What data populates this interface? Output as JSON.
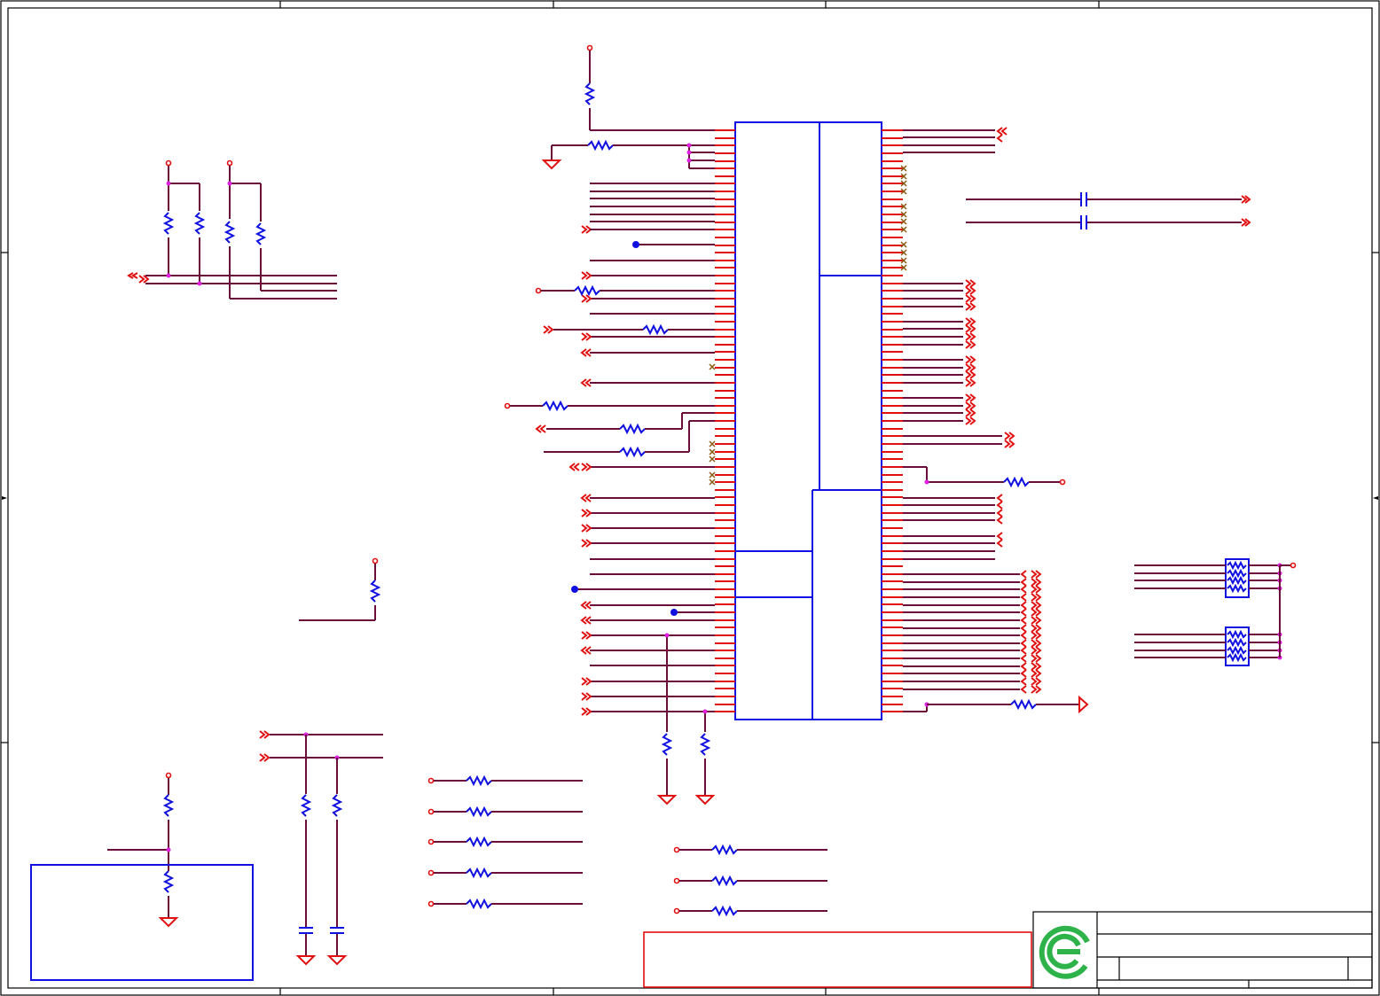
{
  "schematic": {
    "frame_color": "#000000",
    "wire_color": "#6b0f3a",
    "pin_color": "#e01010",
    "component_color": "#1010e0",
    "junction_color": "#e020e0",
    "icons": {
      "logo": "company-logo-icon",
      "ground": "ground-symbol-icon",
      "resistor": "resistor-icon",
      "capacitor": "capacitor-icon",
      "no_connect": "no-connect-x-icon",
      "offpage_connector": "offpage-arrow-icon"
    }
  }
}
